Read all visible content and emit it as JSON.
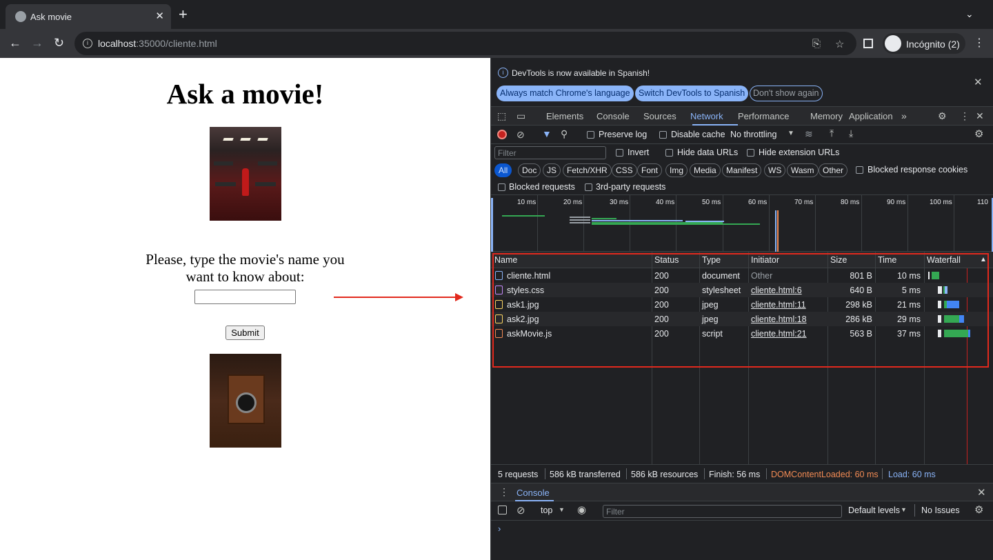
{
  "browser": {
    "tab_title": "Ask movie",
    "url_host": "localhost",
    "url_rest": ":35000/cliente.html",
    "profile_label": "Incógnito (2)"
  },
  "page": {
    "heading": "Ask a movie!",
    "prompt": "Please, type the movie's name you want to know about:",
    "input_value": "",
    "submit_label": "Submit"
  },
  "devtools": {
    "banner": {
      "message": "DevTools is now available in Spanish!",
      "btn_match": "Always match Chrome's language",
      "btn_switch": "Switch DevTools to Spanish",
      "btn_dont": "Don't show again"
    },
    "tabs": [
      "Elements",
      "Console",
      "Sources",
      "Network",
      "Performance",
      "Memory",
      "Application"
    ],
    "active_tab": "Network",
    "toolbar": {
      "preserve_log": "Preserve log",
      "disable_cache": "Disable cache",
      "throttling": "No throttling"
    },
    "filter": {
      "placeholder": "Filter",
      "invert": "Invert",
      "hide_data_urls": "Hide data URLs",
      "hide_extension_urls": "Hide extension URLs"
    },
    "type_chips": [
      "All",
      "Doc",
      "JS",
      "Fetch/XHR",
      "CSS",
      "Font",
      "Img",
      "Media",
      "Manifest",
      "WS",
      "Wasm",
      "Other"
    ],
    "blocked_response_cookies": "Blocked response cookies",
    "blocked_requests": "Blocked requests",
    "third_party_requests": "3rd-party requests",
    "timeline_ticks": [
      "10 ms",
      "20 ms",
      "30 ms",
      "40 ms",
      "50 ms",
      "60 ms",
      "70 ms",
      "80 ms",
      "90 ms",
      "100 ms",
      "110"
    ],
    "columns": {
      "name": "Name",
      "status": "Status",
      "type": "Type",
      "initiator": "Initiator",
      "size": "Size",
      "time": "Time",
      "waterfall": "Waterfall"
    },
    "requests": [
      {
        "name": "cliente.html",
        "status": "200",
        "type": "document",
        "initiator": "Other",
        "size": "801 B",
        "time": "10 ms"
      },
      {
        "name": "styles.css",
        "status": "200",
        "type": "stylesheet",
        "initiator": "cliente.html:6",
        "size": "640 B",
        "time": "5 ms"
      },
      {
        "name": "ask1.jpg",
        "status": "200",
        "type": "jpeg",
        "initiator": "cliente.html:11",
        "size": "298 kB",
        "time": "21 ms"
      },
      {
        "name": "ask2.jpg",
        "status": "200",
        "type": "jpeg",
        "initiator": "cliente.html:18",
        "size": "286 kB",
        "time": "29 ms"
      },
      {
        "name": "askMovie.js",
        "status": "200",
        "type": "script",
        "initiator": "cliente.html:21",
        "size": "563 B",
        "time": "37 ms"
      }
    ],
    "summary": {
      "requests": "5 requests",
      "transferred": "586 kB transferred",
      "resources": "586 kB resources",
      "finish": "Finish: 56 ms",
      "dcl": "DOMContentLoaded: 60 ms",
      "load": "Load: 60 ms"
    },
    "drawer": {
      "tab": "Console",
      "context": "top",
      "filter_placeholder": "Filter",
      "levels": "Default levels",
      "issues": "No Issues"
    }
  },
  "colors": {
    "accent": "#8ab4f8",
    "dcl": "#f28b54",
    "load": "#8ab4f8",
    "annotation": "#e2291d"
  }
}
